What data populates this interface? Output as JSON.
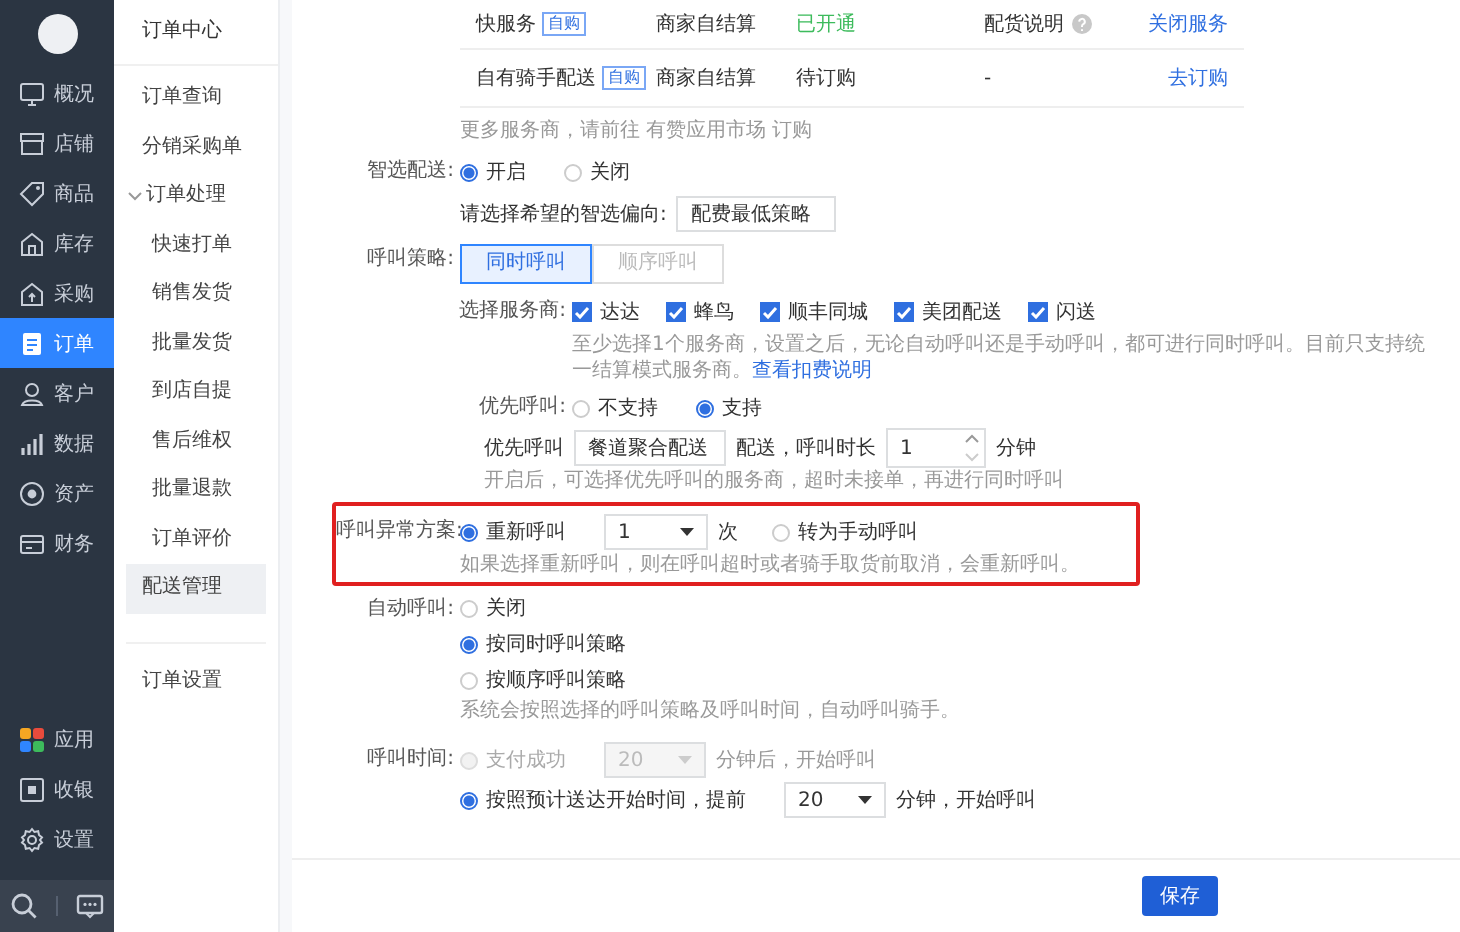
{
  "nav": {
    "items": [
      {
        "label": "概况",
        "selected": false
      },
      {
        "label": "店铺",
        "selected": false
      },
      {
        "label": "商品",
        "selected": false
      },
      {
        "label": "库存",
        "selected": false
      },
      {
        "label": "采购",
        "selected": false
      },
      {
        "label": "订单",
        "selected": true
      },
      {
        "label": "客户",
        "selected": false
      },
      {
        "label": "数据",
        "selected": false
      },
      {
        "label": "资产",
        "selected": false
      },
      {
        "label": "财务",
        "selected": false
      }
    ],
    "bottom_items": [
      {
        "label": "应用"
      },
      {
        "label": "收银"
      },
      {
        "label": "设置"
      }
    ]
  },
  "submenu": {
    "title": "订单中心",
    "items": [
      {
        "label": "订单查询",
        "selected": false
      },
      {
        "label": "分销采购单",
        "selected": false
      },
      {
        "label": "订单处理",
        "selected": false,
        "expanded": true,
        "children": [
          {
            "label": "快速打单",
            "selected": false
          },
          {
            "label": "销售发货",
            "selected": false
          },
          {
            "label": "批量发货",
            "selected": false
          },
          {
            "label": "到店自提",
            "selected": false
          },
          {
            "label": "售后维权",
            "selected": false
          },
          {
            "label": "批量退款",
            "selected": false
          },
          {
            "label": "订单评价",
            "selected": false
          }
        ]
      },
      {
        "label": "配送管理",
        "selected": true
      }
    ],
    "footer_item": "订单设置"
  },
  "services": [
    {
      "name": "快服务",
      "tag": "自购",
      "settlement": "商家自结算",
      "status": "已开通",
      "color": "#3dbb5c",
      "info": "配货说明",
      "info_help": true,
      "action": "关闭服务"
    },
    {
      "name": "自有骑手配送",
      "tag": "自购",
      "settlement": "商家自结算",
      "status": "待订购",
      "color": "#333333",
      "info": "-",
      "info_help": false,
      "action": "去订购"
    }
  ],
  "services_note": {
    "text": "更多服务商，请前往",
    "link": "有赞应用市场",
    "after": "订购"
  },
  "smart_delivery": {
    "label": "智选配送:",
    "options": [
      {
        "label": "开启",
        "selected": true
      },
      {
        "label": "关闭",
        "selected": false
      }
    ],
    "preference_label": "请选择希望的智选偏向:",
    "preference_value": "配费最低策略"
  },
  "call_strategy": {
    "label": "呼叫策略:",
    "tabs": [
      {
        "label": "同时呼叫",
        "selected": true
      },
      {
        "label": "顺序呼叫",
        "selected": false
      }
    ]
  },
  "providers": {
    "label": "选择服务商:",
    "items": [
      {
        "label": "达达",
        "checked": true
      },
      {
        "label": "蜂鸟",
        "checked": true
      },
      {
        "label": "顺丰同城",
        "checked": true
      },
      {
        "label": "美团配送",
        "checked": true
      },
      {
        "label": "闪送",
        "checked": true
      }
    ],
    "note": "至少选择1个服务商，设置之后，无论自动呼叫还是手动呼叫，都可进行同时呼叫。目前只支持统一结算模式服务商。",
    "note_link": "查看扣费说明"
  },
  "priority_call": {
    "label": "优先呼叫:",
    "options": [
      {
        "label": "不支持",
        "selected": false
      },
      {
        "label": "支持",
        "selected": true
      }
    ],
    "prefix": "优先呼叫",
    "provider": "餐道聚合配送",
    "middle": "配送，呼叫时长",
    "duration": "1",
    "unit": "分钟",
    "note": "开启后，可选择优先呼叫的服务商，超时未接单，再进行同时呼叫"
  },
  "call_exception": {
    "label": "呼叫异常方案:",
    "highlighted": true,
    "retry": {
      "label": "重新呼叫",
      "selected": true,
      "count": "1",
      "unit": "次"
    },
    "manual": {
      "label": "转为手动呼叫",
      "selected": false
    },
    "note": "如果选择重新呼叫，则在呼叫超时或者骑手取货前取消，会重新呼叫。"
  },
  "auto_call": {
    "label": "自动呼叫:",
    "options": [
      {
        "label": "关闭",
        "selected": false
      },
      {
        "label": "按同时呼叫策略",
        "selected": true
      },
      {
        "label": "按顺序呼叫策略",
        "selected": false
      }
    ],
    "note": "系统会按照选择的呼叫策略及呼叫时间，自动呼叫骑手。"
  },
  "call_time": {
    "label": "呼叫时间:",
    "options": [
      {
        "label": "支付成功",
        "selected": false,
        "disabled": true,
        "value": "20",
        "suffix": "分钟后，开始呼叫"
      },
      {
        "label": "按照预计送达开始时间，提前",
        "selected": true,
        "disabled": false,
        "value": "20",
        "suffix": "分钟，开始呼叫"
      }
    ]
  },
  "save_button": "保存"
}
